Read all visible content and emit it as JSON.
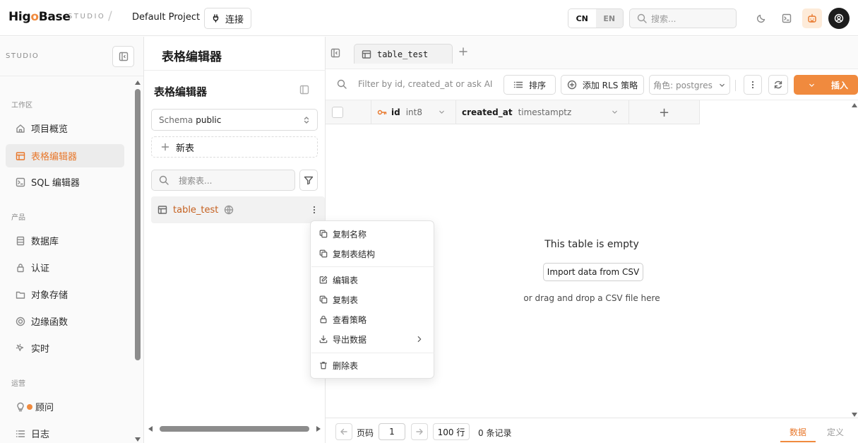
{
  "topbar": {
    "logo_pre": "Hig",
    "logo_o": "o",
    "logo_post": "Base",
    "studio": "STUDIO",
    "slash": "/",
    "project": "Default Project",
    "connect": "连接",
    "lang_cn": "CN",
    "lang_en": "EN",
    "search_placeholder": "搜索..."
  },
  "sidebar": {
    "studio": "STUDIO",
    "sections": {
      "workspace": "工作区",
      "product": "产品",
      "ops": "运营"
    },
    "items": {
      "overview": "项目概览",
      "table_editor": "表格编辑器",
      "sql_editor": "SQL 编辑器",
      "database": "数据库",
      "auth": "认证",
      "storage": "对象存储",
      "functions": "边缘函数",
      "realtime": "实时",
      "advisor": "顾问",
      "logs": "日志"
    }
  },
  "table_panel": {
    "title": "表格编辑器",
    "subtitle": "表格编辑器",
    "schema_label": "Schema",
    "schema_value": "public",
    "new_table": "新表",
    "search_placeholder": "搜索表...",
    "table_name": "table_test"
  },
  "context_menu": {
    "copy_name": "复制名称",
    "copy_structure": "复制表结构",
    "edit": "编辑表",
    "duplicate": "复制表",
    "policies": "查看策略",
    "export": "导出数据",
    "delete": "删除表"
  },
  "main": {
    "tab": "table_test",
    "filter_placeholder": "Filter by id, created_at or ask AI",
    "sort": "排序",
    "add_rls": "添加 RLS 策略",
    "role": "角色: postgres",
    "insert": "插入",
    "columns": [
      {
        "name": "id",
        "type": "int8"
      },
      {
        "name": "created_at",
        "type": "timestamptz"
      }
    ],
    "add_column": "+",
    "empty_title": "This table is empty",
    "import_csv": "Import data from CSV",
    "empty_sub": "or drag and drop a CSV file here"
  },
  "footer": {
    "page_label": "页码",
    "page_value": "1",
    "rows": "100 行",
    "records": "0 条记录",
    "tab_data": "数据",
    "tab_definition": "定义"
  },
  "colors": {
    "accent": "#f08a3e",
    "accent_text": "#e8782c"
  }
}
